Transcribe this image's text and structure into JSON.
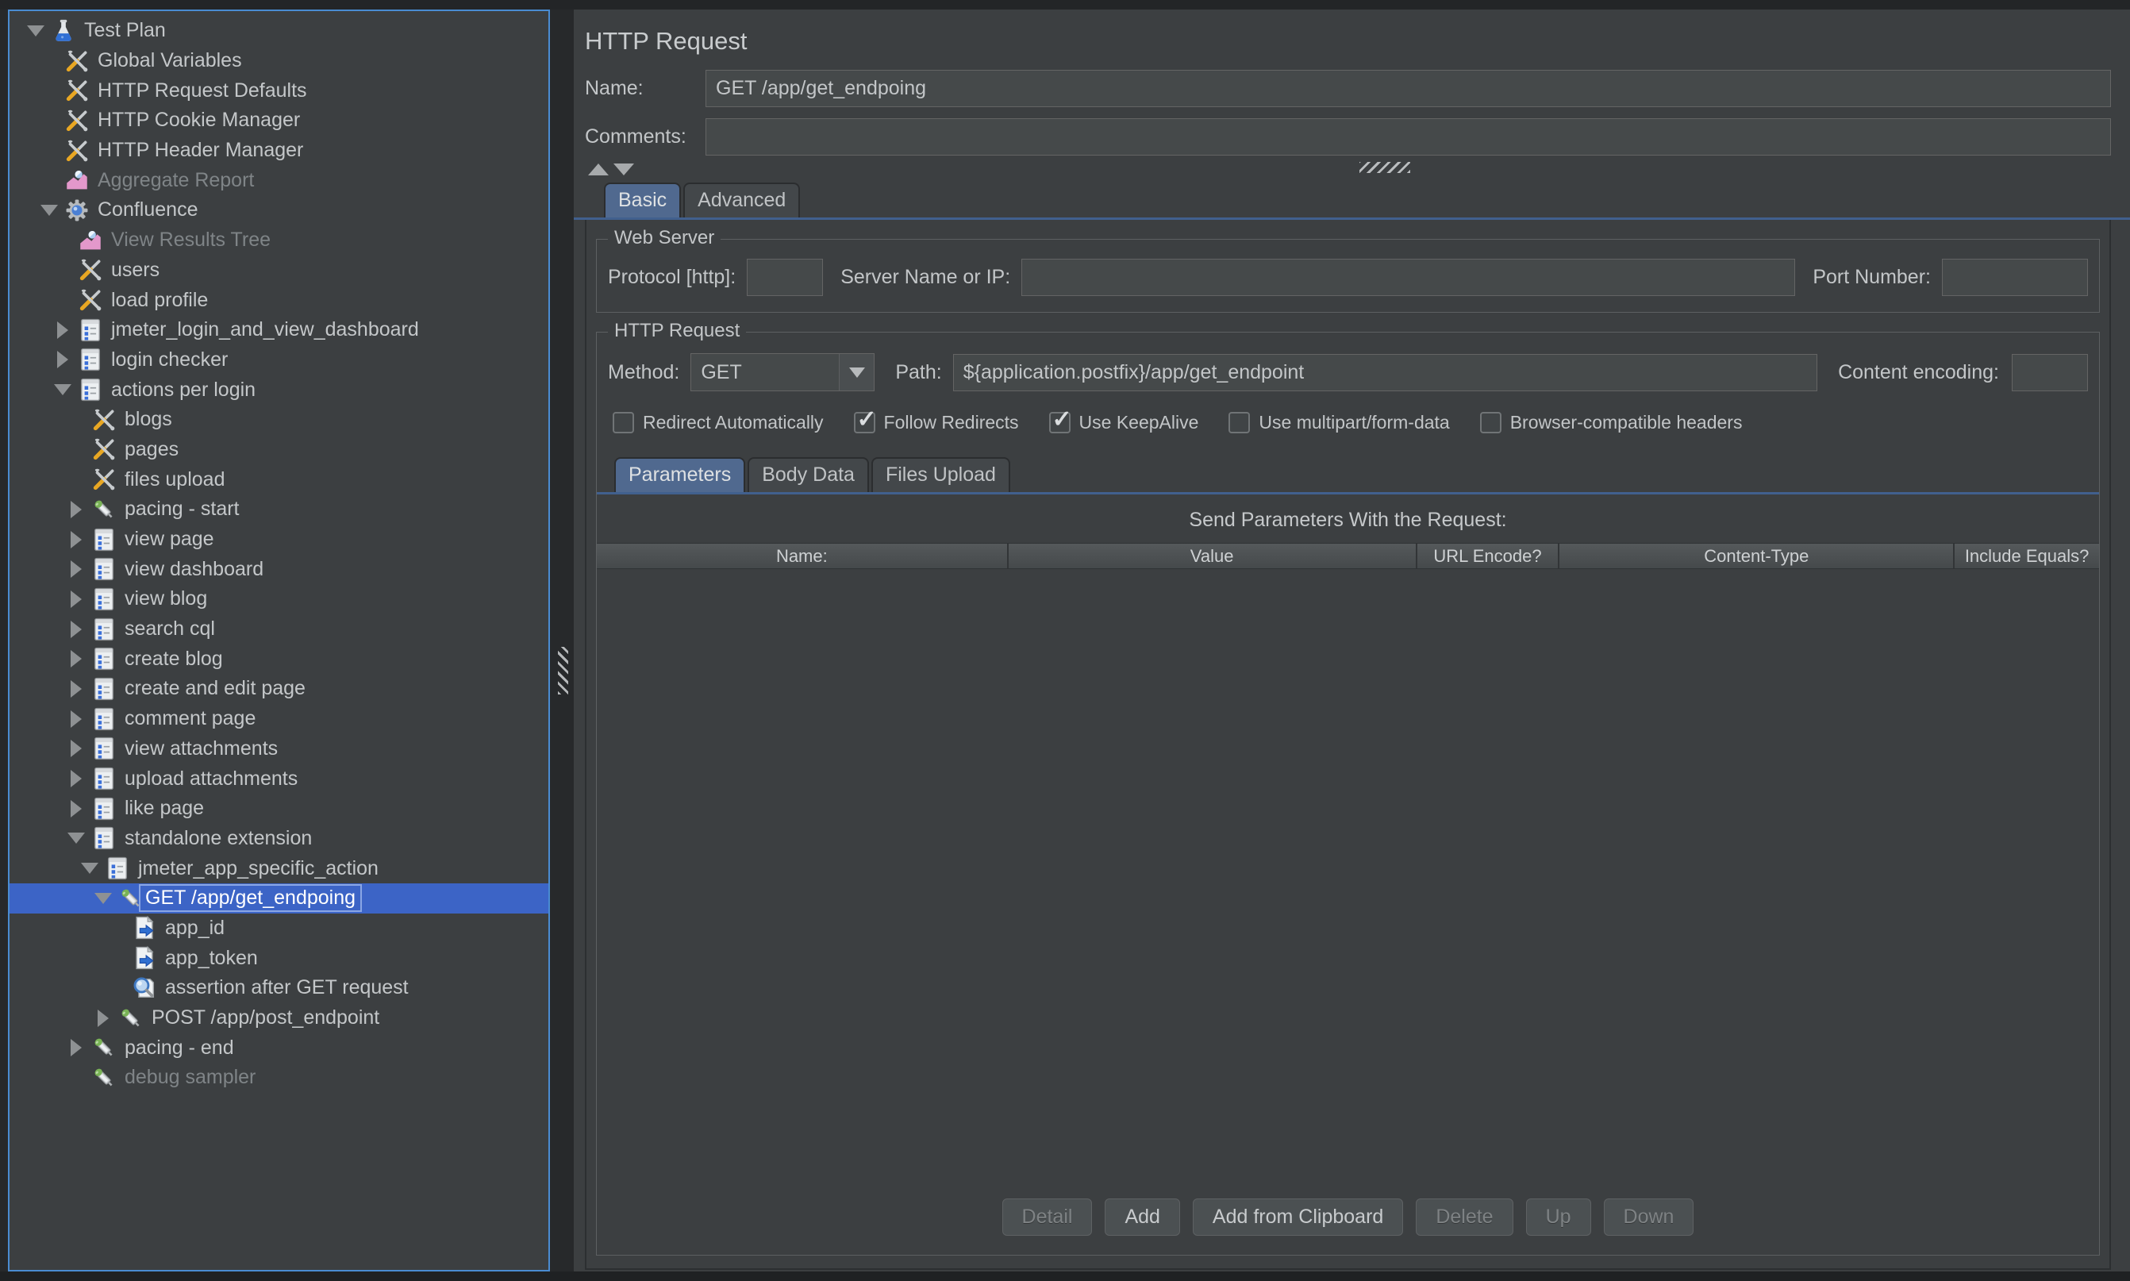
{
  "colors": {
    "background": "#3c3f41",
    "tree_focus_border": "#4a8cd2",
    "selection_blue": "#3c64c6",
    "selection_label_border": "#8aa6e4",
    "selected_tab_blue": "#50698f",
    "tab_underline_blue": "#41608e",
    "field_background": "#45494a",
    "field_border": "#646464"
  },
  "tree": {
    "items": [
      {
        "label": "Test Plan",
        "depth": 0,
        "icon": "test-plan",
        "expander": "expanded",
        "disabled": false,
        "selected": false
      },
      {
        "label": "Global Variables",
        "depth": 1,
        "icon": "config",
        "expander": "none",
        "disabled": false,
        "selected": false
      },
      {
        "label": "HTTP Request Defaults",
        "depth": 1,
        "icon": "config",
        "expander": "none",
        "disabled": false,
        "selected": false
      },
      {
        "label": "HTTP Cookie Manager",
        "depth": 1,
        "icon": "config",
        "expander": "none",
        "disabled": false,
        "selected": false
      },
      {
        "label": "HTTP Header Manager",
        "depth": 1,
        "icon": "config",
        "expander": "none",
        "disabled": false,
        "selected": false
      },
      {
        "label": "Aggregate Report",
        "depth": 1,
        "icon": "report",
        "expander": "none",
        "disabled": true,
        "selected": false
      },
      {
        "label": "Confluence",
        "depth": 1,
        "icon": "thread-group",
        "expander": "expanded",
        "disabled": false,
        "selected": false
      },
      {
        "label": "View Results Tree",
        "depth": 2,
        "icon": "report",
        "expander": "none",
        "disabled": true,
        "selected": false
      },
      {
        "label": "users",
        "depth": 2,
        "icon": "config",
        "expander": "none",
        "disabled": false,
        "selected": false
      },
      {
        "label": "load profile",
        "depth": 2,
        "icon": "config",
        "expander": "none",
        "disabled": false,
        "selected": false
      },
      {
        "label": "jmeter_login_and_view_dashboard",
        "depth": 2,
        "icon": "controller",
        "expander": "collapsed",
        "disabled": false,
        "selected": false
      },
      {
        "label": "login checker",
        "depth": 2,
        "icon": "controller",
        "expander": "collapsed",
        "disabled": false,
        "selected": false
      },
      {
        "label": "actions per login",
        "depth": 2,
        "icon": "controller",
        "expander": "expanded",
        "disabled": false,
        "selected": false
      },
      {
        "label": "blogs",
        "depth": 3,
        "icon": "config",
        "expander": "none",
        "disabled": false,
        "selected": false
      },
      {
        "label": "pages",
        "depth": 3,
        "icon": "config",
        "expander": "none",
        "disabled": false,
        "selected": false
      },
      {
        "label": "files upload",
        "depth": 3,
        "icon": "config",
        "expander": "none",
        "disabled": false,
        "selected": false
      },
      {
        "label": "pacing - start",
        "depth": 3,
        "icon": "sampler",
        "expander": "collapsed",
        "disabled": false,
        "selected": false
      },
      {
        "label": "view page",
        "depth": 3,
        "icon": "controller",
        "expander": "collapsed",
        "disabled": false,
        "selected": false
      },
      {
        "label": "view dashboard",
        "depth": 3,
        "icon": "controller",
        "expander": "collapsed",
        "disabled": false,
        "selected": false
      },
      {
        "label": "view blog",
        "depth": 3,
        "icon": "controller",
        "expander": "collapsed",
        "disabled": false,
        "selected": false
      },
      {
        "label": "search cql",
        "depth": 3,
        "icon": "controller",
        "expander": "collapsed",
        "disabled": false,
        "selected": false
      },
      {
        "label": "create blog",
        "depth": 3,
        "icon": "controller",
        "expander": "collapsed",
        "disabled": false,
        "selected": false
      },
      {
        "label": "create and edit page",
        "depth": 3,
        "icon": "controller",
        "expander": "collapsed",
        "disabled": false,
        "selected": false
      },
      {
        "label": "comment page",
        "depth": 3,
        "icon": "controller",
        "expander": "collapsed",
        "disabled": false,
        "selected": false
      },
      {
        "label": "view attachments",
        "depth": 3,
        "icon": "controller",
        "expander": "collapsed",
        "disabled": false,
        "selected": false
      },
      {
        "label": "upload attachments",
        "depth": 3,
        "icon": "controller",
        "expander": "collapsed",
        "disabled": false,
        "selected": false
      },
      {
        "label": "like page",
        "depth": 3,
        "icon": "controller",
        "expander": "collapsed",
        "disabled": false,
        "selected": false
      },
      {
        "label": "standalone extension",
        "depth": 3,
        "icon": "controller",
        "expander": "expanded",
        "disabled": false,
        "selected": false
      },
      {
        "label": "jmeter_app_specific_action",
        "depth": 4,
        "icon": "controller",
        "expander": "expanded",
        "disabled": false,
        "selected": false
      },
      {
        "label": "GET /app/get_endpoing",
        "depth": 5,
        "icon": "sampler",
        "expander": "expanded",
        "disabled": false,
        "selected": true
      },
      {
        "label": "app_id",
        "depth": 6,
        "icon": "param",
        "expander": "none",
        "disabled": false,
        "selected": false
      },
      {
        "label": "app_token",
        "depth": 6,
        "icon": "param",
        "expander": "none",
        "disabled": false,
        "selected": false
      },
      {
        "label": "assertion after GET request",
        "depth": 6,
        "icon": "assertion",
        "expander": "none",
        "disabled": false,
        "selected": false
      },
      {
        "label": "POST /app/post_endpoint",
        "depth": 5,
        "icon": "sampler",
        "expander": "collapsed",
        "disabled": false,
        "selected": false
      },
      {
        "label": "pacing - end",
        "depth": 3,
        "icon": "sampler",
        "expander": "collapsed",
        "disabled": false,
        "selected": false
      },
      {
        "label": "debug sampler",
        "depth": 3,
        "icon": "sampler",
        "expander": "none",
        "disabled": true,
        "selected": false
      }
    ]
  },
  "main": {
    "title": "HTTP Request",
    "name": {
      "label": "Name:",
      "value": "GET /app/get_endpoing"
    },
    "comments": {
      "label": "Comments:",
      "value": ""
    },
    "view_tabs": [
      {
        "label": "Basic",
        "selected": true
      },
      {
        "label": "Advanced",
        "selected": false
      }
    ],
    "web_server": {
      "title": "Web Server",
      "protocol_label": "Protocol [http]:",
      "protocol_value": "",
      "server_label": "Server Name or IP:",
      "server_value": "",
      "port_label": "Port Number:",
      "port_value": ""
    },
    "http_request": {
      "title": "HTTP Request",
      "method_label": "Method:",
      "method_value": "GET",
      "path_label": "Path:",
      "path_value": "${application.postfix}/app/get_endpoint",
      "content_encoding_label": "Content encoding:",
      "content_encoding_value": "",
      "checkboxes": [
        {
          "label": "Redirect Automatically",
          "checked": false
        },
        {
          "label": "Follow Redirects",
          "checked": true
        },
        {
          "label": "Use KeepAlive",
          "checked": true
        },
        {
          "label": "Use multipart/form-data",
          "checked": false
        },
        {
          "label": "Browser-compatible headers",
          "checked": false
        }
      ],
      "param_tabs": [
        {
          "label": "Parameters",
          "selected": true
        },
        {
          "label": "Body Data",
          "selected": false
        },
        {
          "label": "Files Upload",
          "selected": false
        }
      ],
      "table": {
        "caption": "Send Parameters With the Request:",
        "columns": [
          {
            "label": "Name:",
            "width": 27.4
          },
          {
            "label": "Value",
            "width": 27.2
          },
          {
            "label": "URL Encode?",
            "width": 9.5
          },
          {
            "label": "Content-Type",
            "width": 26.3
          },
          {
            "label": "Include Equals?",
            "width": 9.6
          }
        ],
        "rows": []
      },
      "buttons": [
        {
          "label": "Detail",
          "enabled": false
        },
        {
          "label": "Add",
          "enabled": true
        },
        {
          "label": "Add from Clipboard",
          "enabled": true
        },
        {
          "label": "Delete",
          "enabled": false
        },
        {
          "label": "Up",
          "enabled": false
        },
        {
          "label": "Down",
          "enabled": false
        }
      ]
    }
  }
}
